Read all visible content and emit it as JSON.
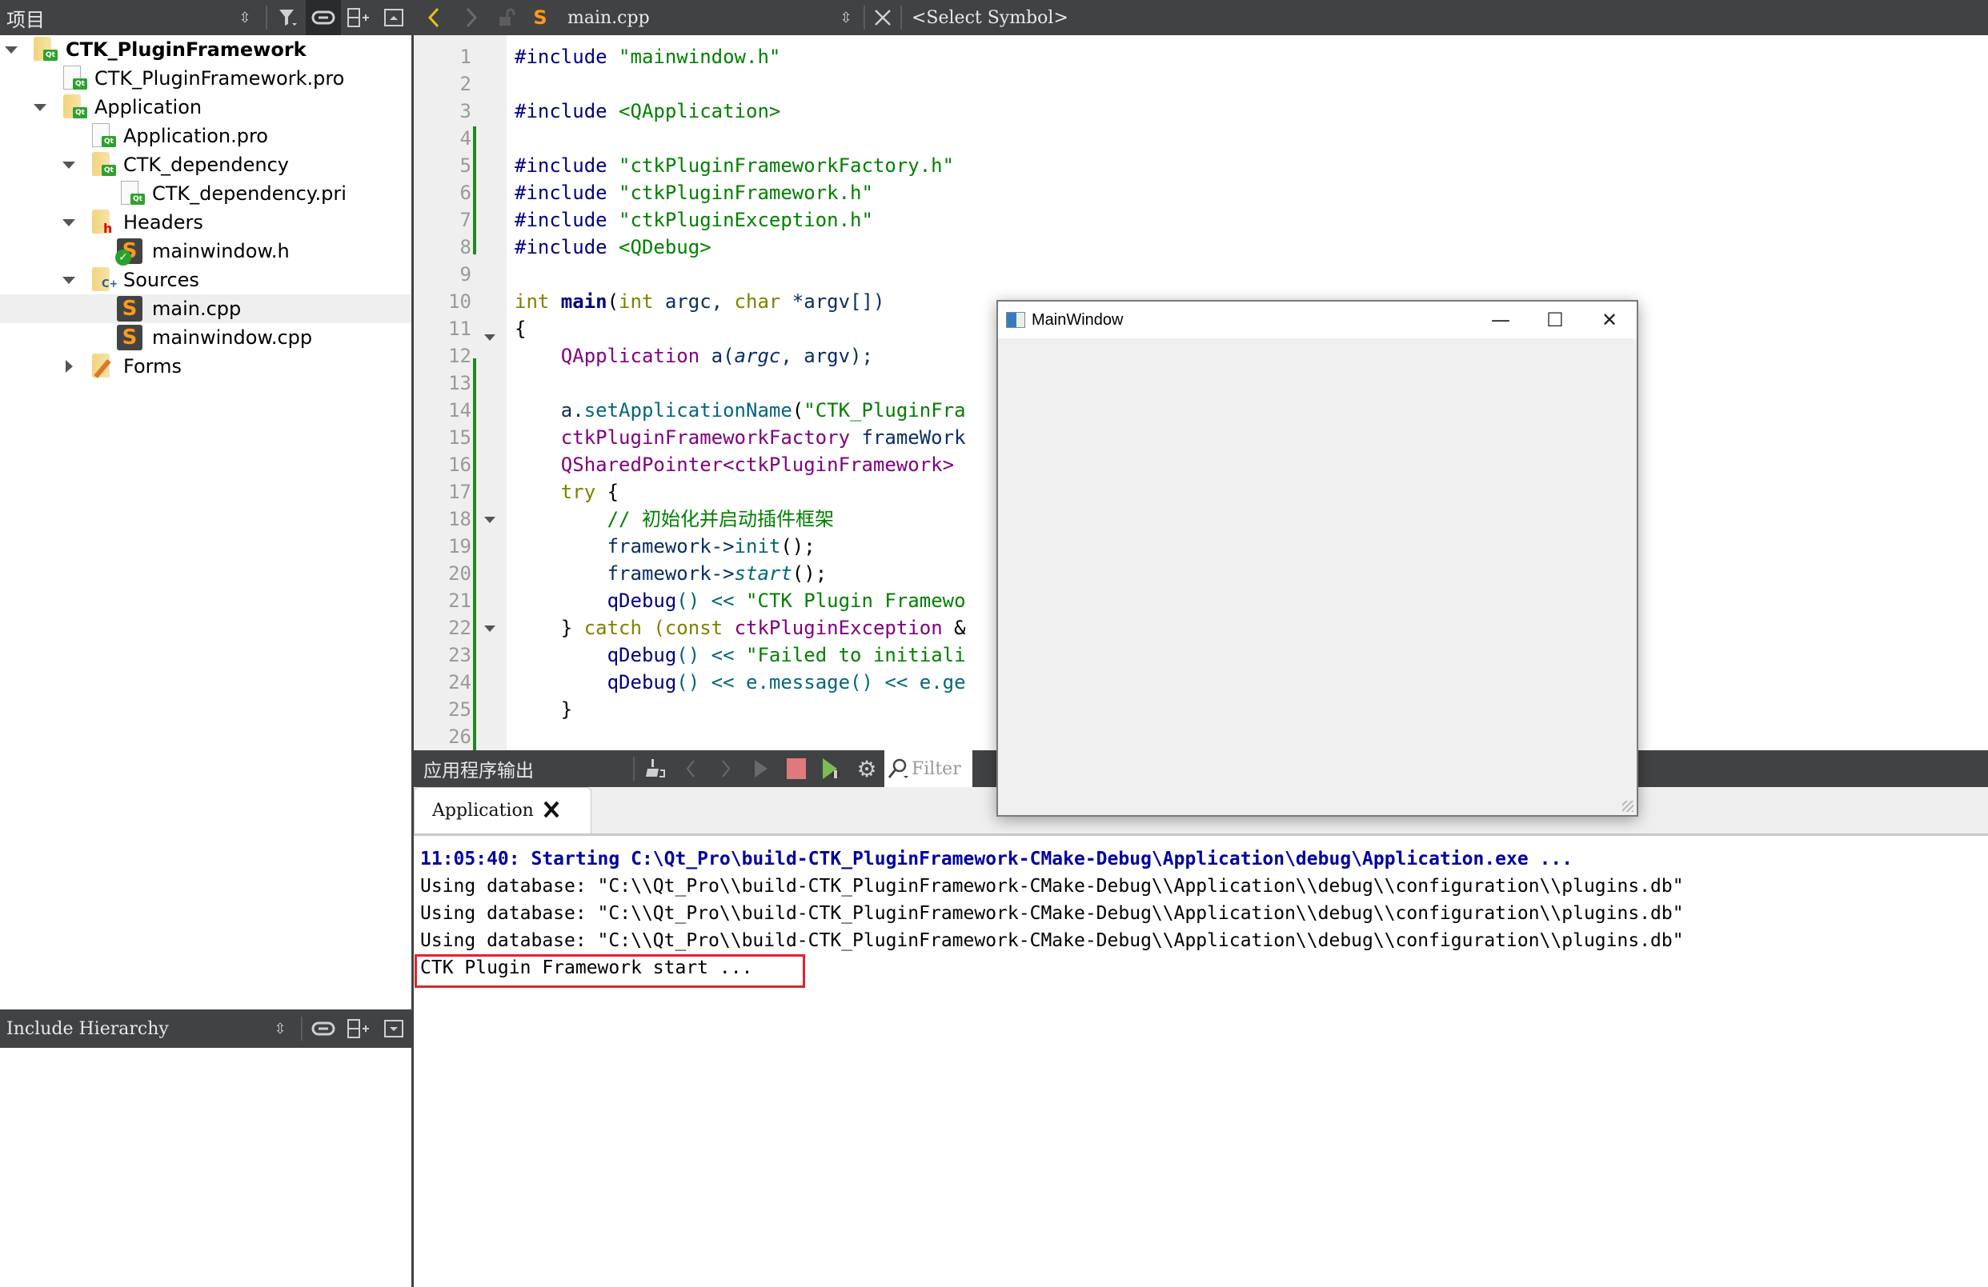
{
  "sidebar": {
    "title": "项目",
    "tree": [
      {
        "label": "CTK_PluginFramework",
        "icon": "qt-project-folder-icon",
        "bold": true,
        "expanded": true
      },
      {
        "label": "CTK_PluginFramework.pro",
        "icon": "qt-pro-file-icon"
      },
      {
        "label": "Application",
        "icon": "qt-project-folder-icon",
        "expanded": true
      },
      {
        "label": "Application.pro",
        "icon": "qt-pro-file-icon"
      },
      {
        "label": "CTK_dependency",
        "icon": "qt-project-folder-icon",
        "expanded": true
      },
      {
        "label": "CTK_dependency.pri",
        "icon": "qt-pri-file-icon"
      },
      {
        "label": "Headers",
        "icon": "headers-folder-icon",
        "expanded": true
      },
      {
        "label": "mainwindow.h",
        "icon": "header-file-icon"
      },
      {
        "label": "Sources",
        "icon": "sources-folder-icon",
        "expanded": true
      },
      {
        "label": "main.cpp",
        "icon": "cpp-file-icon",
        "selected": true
      },
      {
        "label": "mainwindow.cpp",
        "icon": "cpp-file-icon"
      },
      {
        "label": "Forms",
        "icon": "forms-folder-icon",
        "expanded": false
      }
    ],
    "include_hierarchy_title": "Include Hierarchy"
  },
  "editor_bar": {
    "file_name": "main.cpp",
    "symbol_placeholder": "<Select Symbol>"
  },
  "editor": {
    "line_numbers": [
      "1",
      "2",
      "3",
      "4",
      "5",
      "6",
      "7",
      "8",
      "9",
      "10",
      "11",
      "12",
      "13",
      "14",
      "15",
      "16",
      "17",
      "18",
      "19",
      "20",
      "21",
      "22",
      "23",
      "24",
      "25",
      "26"
    ],
    "lines": {
      "l1": {
        "pp": "#include ",
        "str": "\"mainwindow.h\""
      },
      "l3": {
        "pp": "#include ",
        "str": "<QApplication>"
      },
      "l5": {
        "pp": "#include ",
        "str": "\"ctkPluginFrameworkFactory.h\""
      },
      "l6": {
        "pp": "#include ",
        "str": "\"ctkPluginFramework.h\""
      },
      "l7": {
        "pp": "#include ",
        "str": "\"ctkPluginException.h\""
      },
      "l8": {
        "pp": "#include ",
        "str": "<QDebug>"
      },
      "l10": {
        "t1": "int ",
        "t2": "main",
        "t3": "(",
        "t4": "int ",
        "t5": "argc, ",
        "t6": "char ",
        "t7": "*argv[])"
      },
      "l11": {
        "t1": "{"
      },
      "l12": {
        "t1": "    ",
        "t2": "QApplication",
        "t3": " a(",
        "t4": "argc",
        "t5": ", argv);"
      },
      "l14": {
        "t1": "    a.",
        "t2": "setApplicationName",
        "t3": "(",
        "t4": "\"CTK_PluginFra"
      },
      "l15": {
        "t1": "    ",
        "t2": "ctkPluginFrameworkFactory",
        "t3": " frameWork"
      },
      "l16": {
        "t1": "    ",
        "t2": "QSharedPointer<ctkPluginFramework>"
      },
      "l17": {
        "t1": "    ",
        "t2": "try",
        "t3": " {"
      },
      "l18": {
        "t1": "        ",
        "t2": "// 初始化并启动插件框架"
      },
      "l19": {
        "t1": "        framework->",
        "t2": "init",
        "t3": "();"
      },
      "l20": {
        "t1": "        framework->",
        "t2": "start",
        "t3": "();"
      },
      "l21": {
        "t1": "        ",
        "t2": "qDebug",
        "t3": "() << ",
        "t4": "\"CTK Plugin Framewo"
      },
      "l22": {
        "t1": "    } ",
        "t2": "catch",
        "t3": " (",
        "t4": "const ",
        "t5": "ctkPluginException",
        "t6": " &"
      },
      "l23": {
        "t1": "        ",
        "t2": "qDebug",
        "t3": "() << ",
        "t4": "\"Failed to initiali"
      },
      "l24": {
        "t1": "        ",
        "t2": "qDebug",
        "t3": "() << e.",
        "t4": "message",
        "t5": "() << e.",
        "t6": "ge"
      },
      "l25": {
        "t1": "    }"
      }
    }
  },
  "output": {
    "title": "应用程序输出",
    "filter_placeholder": "Filter",
    "tab_label": "Application",
    "lines": [
      "11:05:40: Starting C:\\Qt_Pro\\build-CTK_PluginFramework-CMake-Debug\\Application\\debug\\Application.exe ...",
      "Using database: \"C:\\\\Qt_Pro\\\\build-CTK_PluginFramework-CMake-Debug\\\\Application\\\\debug\\\\configuration\\\\plugins.db\"",
      "Using database: \"C:\\\\Qt_Pro\\\\build-CTK_PluginFramework-CMake-Debug\\\\Application\\\\debug\\\\configuration\\\\plugins.db\"",
      "Using database: \"C:\\\\Qt_Pro\\\\build-CTK_PluginFramework-CMake-Debug\\\\Application\\\\debug\\\\configuration\\\\plugins.db\"",
      "CTK Plugin Framework start ..."
    ],
    "highlight_color": "#e0242e"
  },
  "main_window": {
    "title": "MainWindow",
    "minimize": "—",
    "maximize": "☐",
    "close": "✕"
  },
  "colors": {
    "toolbar_bg": "#404244",
    "stop_red": "#e07a7a",
    "run_debug_green": "#7dbb55",
    "nav_back_yellow": "#e8c020",
    "modified_bar_green": "#1d8a1d"
  }
}
